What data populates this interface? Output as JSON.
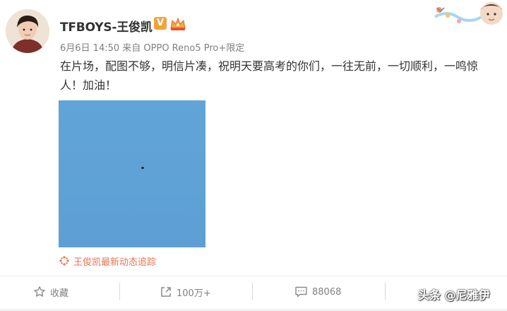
{
  "post": {
    "author": "TFBOYS-王俊凯",
    "vip_mark": "V",
    "meta": "6月6日 14:50 来自 OPPO Reno5 Pro+限定",
    "text": "在片场，配图不够，明信片凑，祝明天要高考的你们，一往无前，一切顺利，一鸣惊人！加油！",
    "tracker_label": "王俊凯最新动态追踪"
  },
  "actions": {
    "favorite_label": "收藏",
    "repost_count": "100万+",
    "comment_count": "88068"
  },
  "watermark": "头条 @尼雅伊",
  "colors": {
    "accent": "#eb7350",
    "sky": "#5fa2d6",
    "meta_gray": "#808080"
  }
}
